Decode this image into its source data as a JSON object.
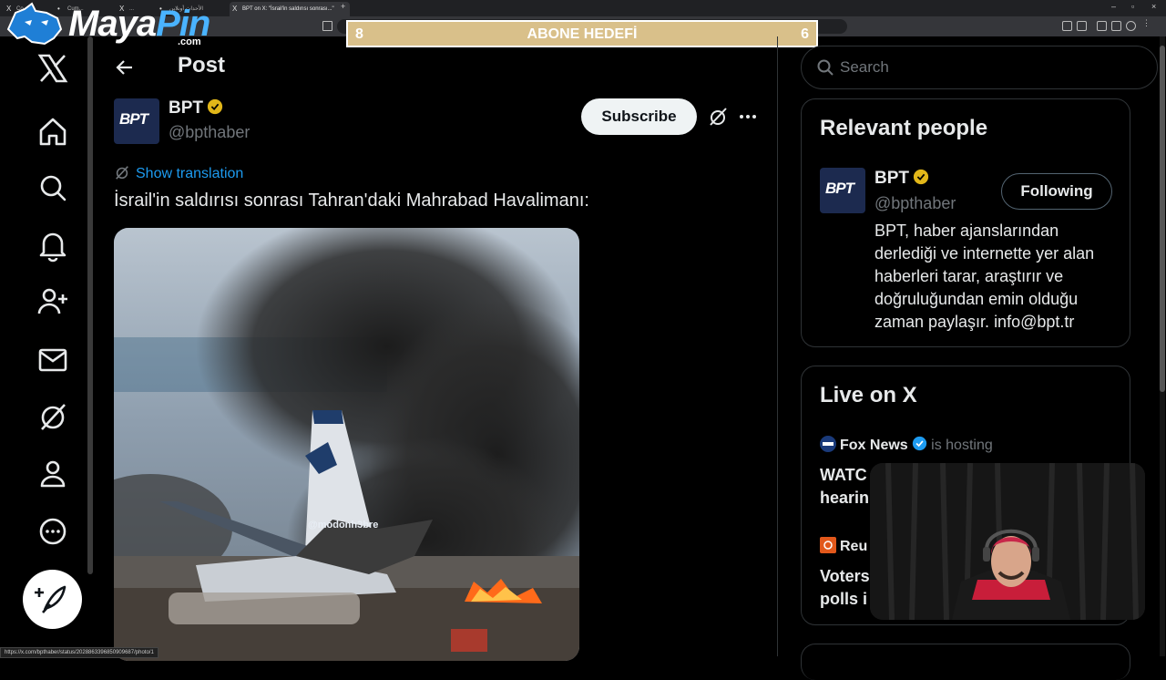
{
  "browser": {
    "tabs": [
      {
        "title": "Co..."
      },
      {
        "title": "Cum..."
      },
      {
        "title": "..."
      },
      {
        "title": "الأحداث أونلاين"
      },
      {
        "title": "BPT on X: \"İsrail'in saldırısı sonrası...\""
      }
    ],
    "new_tab": "+",
    "window_controls": [
      "–",
      "▫",
      "×"
    ],
    "status_url": "https://x.com/bpthaber/status/2028863396850909687/photo/1"
  },
  "overlay": {
    "logo_main": "Maya",
    "logo_accent": "Pin",
    "logo_suffix": ".com",
    "goal_label": "ABONE HEDEFİ",
    "goal_left": "8",
    "goal_right": "6"
  },
  "nav": {
    "items": [
      "x-logo",
      "home",
      "explore",
      "notifications",
      "follow",
      "messages",
      "grok",
      "profile",
      "more"
    ]
  },
  "post": {
    "header_title": "Post",
    "author_name": "BPT",
    "author_handle": "@bpthaber",
    "avatar_text": "BPT",
    "subscribe_label": "Subscribe",
    "translate_label": "Show translation",
    "text": "İsrail'in saldırısı sonrası Tahran'daki Mahrabad Havalimanı:",
    "watermark": "@modonh3bre"
  },
  "sidebar": {
    "search_placeholder": "Search",
    "relevant_people": {
      "heading": "Relevant people",
      "name": "BPT",
      "handle": "@bpthaber",
      "follow_label": "Following",
      "bio_lines": [
        "BPT, haber ajanslarından",
        "derlediği ve internette yer alan",
        "haberleri tarar, araştırır ve",
        "doğruluğundan emin olduğu",
        "zaman paylaşır. info@bpt.tr"
      ]
    },
    "live": {
      "heading": "Live on X",
      "host1_name": "Fox News",
      "host1_suffix": "is hosting",
      "title1_lines": [
        "WATC",
        "hearin"
      ],
      "host2_name": "Reu",
      "title2_lines": [
        "Voters",
        "polls i"
      ]
    }
  },
  "colors": {
    "accent": "#1d9bf0",
    "verified_gold": "#e2b719",
    "verified_blue": "#1d9bf0",
    "goal_bg": "#d9c08a"
  }
}
